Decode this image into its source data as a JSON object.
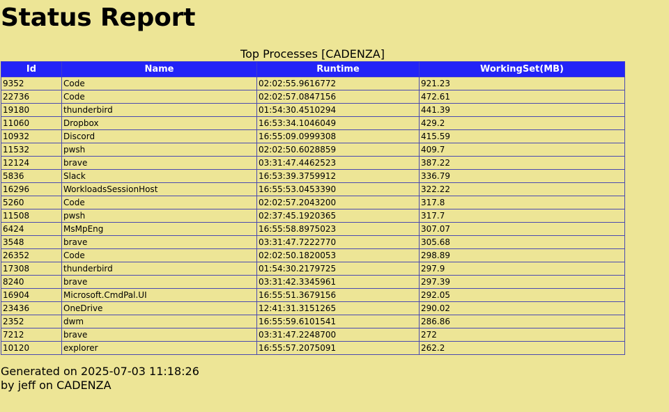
{
  "page": {
    "title": "Status Report",
    "caption": "Top Processes [CADENZA]"
  },
  "table": {
    "headers": [
      "Id",
      "Name",
      "Runtime",
      "WorkingSet(MB)"
    ],
    "rows": [
      [
        "9352",
        "Code",
        "02:02:55.9616772",
        "921.23"
      ],
      [
        "22736",
        "Code",
        "02:02:57.0847156",
        "472.61"
      ],
      [
        "19180",
        "thunderbird",
        "01:54:30.4510294",
        "441.39"
      ],
      [
        "11060",
        "Dropbox",
        "16:53:34.1046049",
        "429.2"
      ],
      [
        "10932",
        "Discord",
        "16:55:09.0999308",
        "415.59"
      ],
      [
        "11532",
        "pwsh",
        "02:02:50.6028859",
        "409.7"
      ],
      [
        "12124",
        "brave",
        "03:31:47.4462523",
        "387.22"
      ],
      [
        "5836",
        "Slack",
        "16:53:39.3759912",
        "336.79"
      ],
      [
        "16296",
        "WorkloadsSessionHost",
        "16:55:53.0453390",
        "322.22"
      ],
      [
        "5260",
        "Code",
        "02:02:57.2043200",
        "317.8"
      ],
      [
        "11508",
        "pwsh",
        "02:37:45.1920365",
        "317.7"
      ],
      [
        "6424",
        "MsMpEng",
        "16:55:58.8975023",
        "307.07"
      ],
      [
        "3548",
        "brave",
        "03:31:47.7222770",
        "305.68"
      ],
      [
        "26352",
        "Code",
        "02:02:50.1820053",
        "298.89"
      ],
      [
        "17308",
        "thunderbird",
        "01:54:30.2179725",
        "297.9"
      ],
      [
        "8240",
        "brave",
        "03:31:42.3345961",
        "297.39"
      ],
      [
        "16904",
        "Microsoft.CmdPal.UI",
        "16:55:51.3679156",
        "292.05"
      ],
      [
        "23436",
        "OneDrive",
        "12:41:31.3151265",
        "290.02"
      ],
      [
        "2352",
        "dwm",
        "16:55:59.6101541",
        "286.86"
      ],
      [
        "7212",
        "brave",
        "03:31:47.2248700",
        "272"
      ],
      [
        "10120",
        "explorer",
        "16:55:57.2075091",
        "262.2"
      ]
    ]
  },
  "footer": {
    "generated": "Generated on 2025-07-03 11:18:26",
    "by": "by jeff on CADENZA"
  }
}
